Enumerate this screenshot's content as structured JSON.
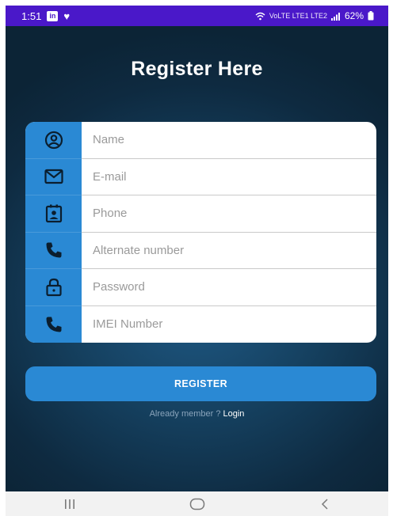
{
  "status_bar": {
    "time": "1:51",
    "linkedin_badge": "in",
    "network": "VoLTE LTE1 LTE2",
    "battery": "62%"
  },
  "header": {
    "title": "Register Here"
  },
  "form": {
    "fields": [
      {
        "icon": "person-circle-icon",
        "placeholder": "Name"
      },
      {
        "icon": "envelope-icon",
        "placeholder": "E-mail"
      },
      {
        "icon": "contact-card-icon",
        "placeholder": "Phone"
      },
      {
        "icon": "phone-icon",
        "placeholder": "Alternate number"
      },
      {
        "icon": "lock-icon",
        "placeholder": "Password"
      },
      {
        "icon": "phone-icon",
        "placeholder": "IMEI Number"
      }
    ]
  },
  "actions": {
    "register_label": "REGISTER",
    "already_member_text": "Already member ?",
    "login_label": "Login"
  },
  "nav": {
    "recent": "recent-apps-icon",
    "home": "home-icon",
    "back": "back-icon"
  },
  "colors": {
    "accent": "#2a89d4",
    "status_bar": "#4a18c9",
    "background_dark": "#0e2a40"
  }
}
